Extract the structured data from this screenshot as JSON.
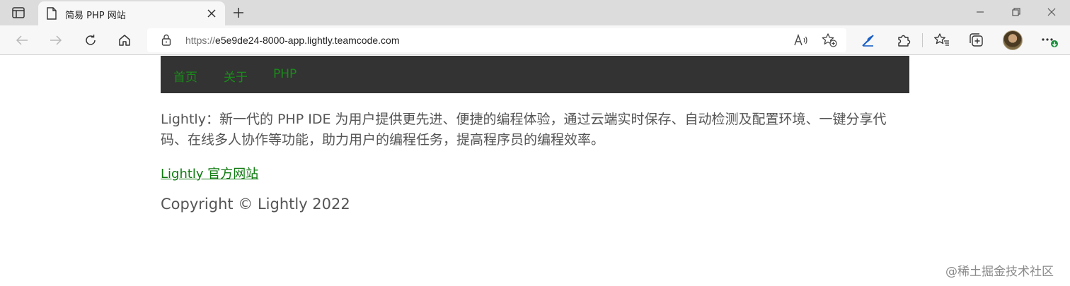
{
  "browser": {
    "tab": {
      "title": "简易 PHP 网站"
    },
    "address_bar": {
      "url_scheme": "https://",
      "url_host": "e5e9de24-8000-app.lightly.teamcode.com"
    },
    "profile": {
      "badge_color": "#1a8f3c"
    }
  },
  "site": {
    "nav": [
      "首页",
      "关于",
      "PHP"
    ],
    "intro": "Lightly：新一代的 PHP IDE 为用户提供更先进、便捷的编程体验，通过云端实时保存、自动检测及配置环境、一键分享代码、在线多人协作等功能，助力用户的编程任务，提高程序员的编程效率。",
    "link_text": "Lightly 官方网站",
    "copyright": "Copyright © Lightly 2022"
  },
  "watermark": "@稀土掘金技术社区",
  "colors": {
    "nav_bg": "#333333",
    "nav_link": "#1a8a1a",
    "link": "#0f7a0f",
    "text": "#555555"
  }
}
